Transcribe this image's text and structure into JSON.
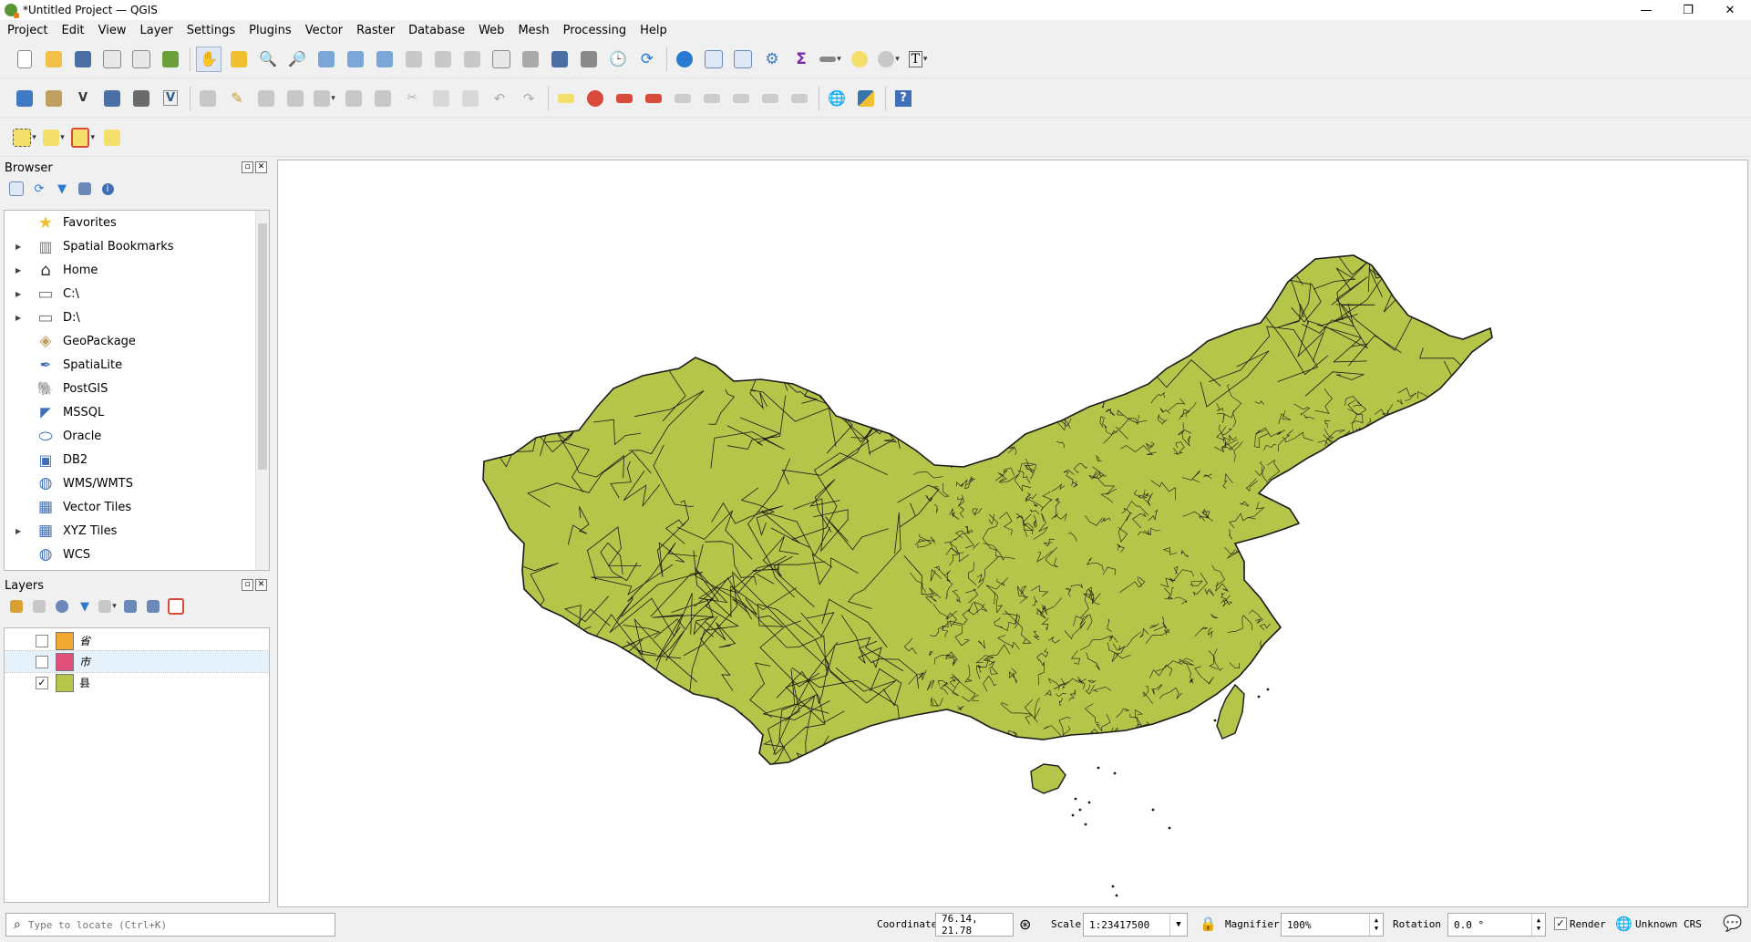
{
  "window": {
    "title": "*Untitled Project — QGIS",
    "controls": [
      "—",
      "❐",
      "✕"
    ]
  },
  "menubar": [
    "Project",
    "Edit",
    "View",
    "Layer",
    "Settings",
    "Plugins",
    "Vector",
    "Raster",
    "Database",
    "Web",
    "Mesh",
    "Processing",
    "Help"
  ],
  "browser": {
    "title": "Browser",
    "items": [
      {
        "label": "Favorites",
        "icon": "star-icon",
        "expandable": false
      },
      {
        "label": "Spatial Bookmarks",
        "icon": "bookmark-icon",
        "expandable": true
      },
      {
        "label": "Home",
        "icon": "home-icon",
        "expandable": true
      },
      {
        "label": "C:\\",
        "icon": "folder-icon",
        "expandable": true
      },
      {
        "label": "D:\\",
        "icon": "folder-icon",
        "expandable": true
      },
      {
        "label": "GeoPackage",
        "icon": "geopackage-icon",
        "expandable": false
      },
      {
        "label": "SpatiaLite",
        "icon": "spatialite-icon",
        "expandable": false
      },
      {
        "label": "PostGIS",
        "icon": "postgis-icon",
        "expandable": false
      },
      {
        "label": "MSSQL",
        "icon": "mssql-icon",
        "expandable": false
      },
      {
        "label": "Oracle",
        "icon": "oracle-icon",
        "expandable": false
      },
      {
        "label": "DB2",
        "icon": "db2-icon",
        "expandable": false
      },
      {
        "label": "WMS/WMTS",
        "icon": "globe-icon",
        "expandable": false
      },
      {
        "label": "Vector Tiles",
        "icon": "grid-icon",
        "expandable": false
      },
      {
        "label": "XYZ Tiles",
        "icon": "grid-icon",
        "expandable": true
      },
      {
        "label": "WCS",
        "icon": "globe-icon",
        "expandable": false
      }
    ]
  },
  "layers": {
    "title": "Layers",
    "items": [
      {
        "name": "省",
        "checked": false,
        "color": "#f0a830"
      },
      {
        "name": "市",
        "checked": false,
        "color": "#e0507a"
      },
      {
        "name": "县",
        "checked": true,
        "color": "#b5c54a"
      }
    ]
  },
  "map": {
    "fill_color": "#b5c54a",
    "stroke_color": "#1a1a1a"
  },
  "statusbar": {
    "locate_placeholder": "Type to locate (Ctrl+K)",
    "coordinate_label": "Coordinate",
    "coordinate_value": "76.14, 21.78",
    "scale_label": "Scale",
    "scale_value": "1:23417500",
    "magnifier_label": "Magnifier",
    "magnifier_value": "100%",
    "rotation_label": "Rotation",
    "rotation_value": "0.0 °",
    "render_label": "Render",
    "crs_label": "Unknown CRS"
  }
}
